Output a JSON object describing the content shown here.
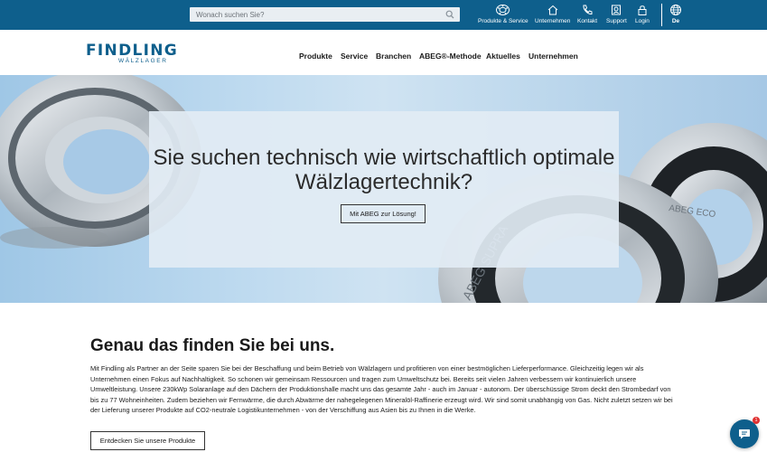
{
  "search": {
    "placeholder": "Wonach suchen Sie?"
  },
  "utility_nav": [
    {
      "label": "Produkte & Service",
      "icon": "bearing-icon"
    },
    {
      "label": "Unternehmen",
      "icon": "home-icon"
    },
    {
      "label": "Kontakt",
      "icon": "phone-icon"
    },
    {
      "label": "Support",
      "icon": "support-icon"
    },
    {
      "label": "Login",
      "icon": "lock-icon"
    },
    {
      "label": "De",
      "icon": "globe-icon"
    }
  ],
  "logo": {
    "line1": "FINDLING",
    "line2": "WÄLZLAGER"
  },
  "main_nav": [
    "Produkte",
    "Service",
    "Branchen",
    "ABEG®-Methode",
    "Aktuelles",
    "Unternehmen"
  ],
  "hero": {
    "title_line1": "Sie suchen technisch wie wirtschaftlich optimale",
    "title_line2": "Wälzlagertechnik?",
    "button": "Mit ABEG zur Lösung!"
  },
  "section": {
    "heading": "Genau das finden Sie bei uns.",
    "paragraph": "Mit Findling als Partner an der Seite sparen Sie bei der Beschaffung und beim Betrieb von Wälzlagern und profitieren von einer bestmöglichen Lieferperformance. Gleichzeitig legen wir als Unternehmen einen Fokus auf Nachhaltigkeit. So schonen wir gemeinsam Ressourcen und tragen zum Umweltschutz bei. Bereits seit vielen Jahren verbessern wir kontinuierlich unsere Umweltleistung. Unsere 230kWp Solaranlage auf den Dächern der Produktionshalle macht uns das gesamte Jahr  - auch im Januar - autonom. Der überschüssige Strom deckt den Strombedarf von bis zu 77 Wohneinheiten. Zudem beziehen wir Fernwärme, die durch Abwärme der nahegelegenen Mineralöl-Raffinerie erzeugt wird. Wir sind somit unabhängig von Gas. Nicht zuletzt setzen wir bei der Lieferung unserer Produkte auf CO2-neutrale Logistikunternehmen - von der Verschiffung aus Asien bis zu Ihnen in die Werke.",
    "cta": "Entdecken Sie unsere Produkte"
  },
  "bearing_text": {
    "left": "ABEG SUPRA",
    "right": "ABEG ECO"
  },
  "chat": {
    "badge": "1"
  },
  "colors": {
    "brand": "#0e5f8c",
    "hero_bg": "#bcd9ef",
    "badge": "#e03131"
  }
}
